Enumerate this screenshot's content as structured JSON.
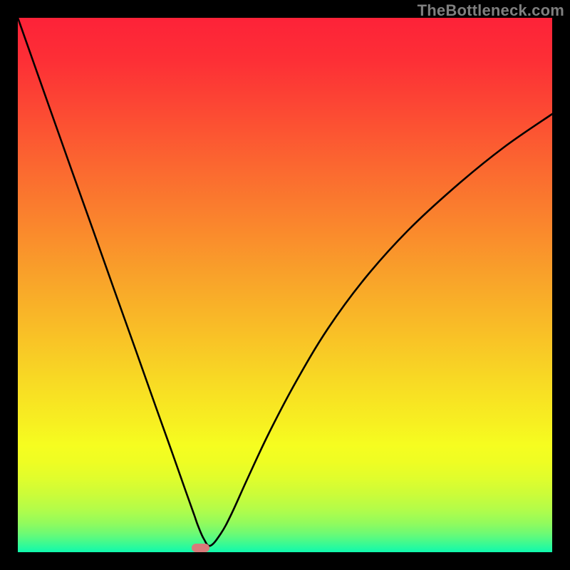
{
  "watermark": "TheBottleneck.com",
  "chart_data": {
    "type": "line",
    "title": "",
    "xlabel": "",
    "ylabel": "",
    "xlim": [
      0,
      100
    ],
    "ylim": [
      0,
      100
    ],
    "grid": false,
    "series": [
      {
        "name": "bottleneck-curve",
        "x": [
          0,
          3,
          6,
          10,
          14,
          18,
          22,
          26,
          29,
          31.5,
          33,
          33.7,
          34.8,
          36,
          38,
          40,
          43,
          47,
          52,
          58,
          65,
          73,
          82,
          91,
          100
        ],
        "values": [
          100,
          91.5,
          83,
          71.7,
          60.5,
          49.2,
          38,
          26.7,
          18.3,
          11.2,
          7,
          5,
          2.5,
          1.2,
          3.5,
          7.2,
          13.8,
          22.3,
          31.8,
          41.8,
          51.3,
          60.2,
          68.5,
          75.8,
          82
        ]
      }
    ],
    "minimum_marker": {
      "x": 34.2,
      "y": 0.8,
      "width_pct": 3.4,
      "height_pct": 1.6
    },
    "background_gradient": {
      "stops": [
        {
          "pos": 0.0,
          "color": "#fd2238"
        },
        {
          "pos": 0.08,
          "color": "#fd2f36"
        },
        {
          "pos": 0.18,
          "color": "#fc4b33"
        },
        {
          "pos": 0.28,
          "color": "#fb6830"
        },
        {
          "pos": 0.38,
          "color": "#fa842d"
        },
        {
          "pos": 0.48,
          "color": "#f9a12a"
        },
        {
          "pos": 0.58,
          "color": "#f9bd27"
        },
        {
          "pos": 0.68,
          "color": "#f8da24"
        },
        {
          "pos": 0.76,
          "color": "#f7f021"
        },
        {
          "pos": 0.8,
          "color": "#f6fd20"
        },
        {
          "pos": 0.83,
          "color": "#effd23"
        },
        {
          "pos": 0.86,
          "color": "#e1fd2c"
        },
        {
          "pos": 0.89,
          "color": "#cdfc38"
        },
        {
          "pos": 0.92,
          "color": "#b3fc49"
        },
        {
          "pos": 0.945,
          "color": "#93fb5c"
        },
        {
          "pos": 0.965,
          "color": "#6dfa74"
        },
        {
          "pos": 0.982,
          "color": "#41fa8f"
        },
        {
          "pos": 1.0,
          "color": "#0ff9ae"
        }
      ]
    }
  }
}
